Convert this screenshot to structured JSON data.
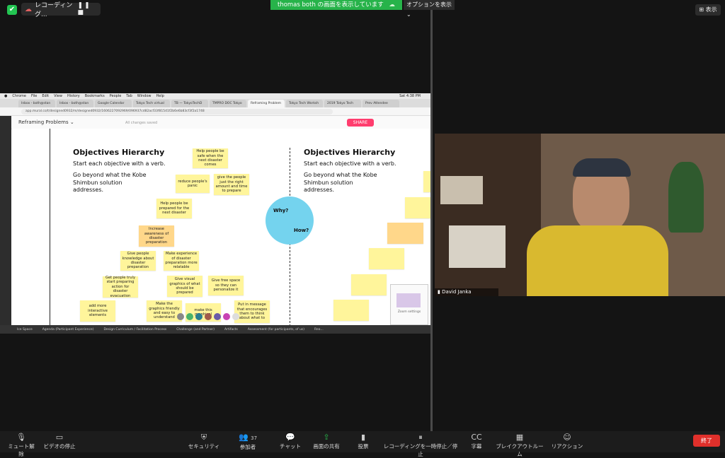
{
  "zoom": {
    "recording_label": "レコーディング...",
    "share_banner": "thomas both の画面を表示しています",
    "options_label": "オプションを表示",
    "view_label": "表示",
    "end_label": "終了",
    "participants_count": "37",
    "toolbar": [
      {
        "label": "ミュート解除",
        "icon": "🎙"
      },
      {
        "label": "ビデオの停止",
        "icon": "▭"
      },
      {
        "label": "セキュリティ",
        "icon": "⛨"
      },
      {
        "label": "参加者",
        "icon": "👥"
      },
      {
        "label": "チャット",
        "icon": "💬"
      },
      {
        "label": "画面の共有",
        "icon": "⇪"
      },
      {
        "label": "投票",
        "icon": "▮"
      },
      {
        "label": "レコーディングを一時停止／停止",
        "icon": "⏸"
      },
      {
        "label": "字幕",
        "icon": "CC"
      },
      {
        "label": "ブレイクアウトルーム",
        "icon": "▦"
      },
      {
        "label": "リアクション",
        "icon": "☺"
      }
    ]
  },
  "video": {
    "name": "David Janka"
  },
  "browser": {
    "mac_menu": [
      "Chrome",
      "File",
      "Edit",
      "View",
      "History",
      "Bookmarks",
      "People",
      "Tab",
      "Window",
      "Help"
    ],
    "clock": "Sat 4:38 PM",
    "tabs": [
      "Inbox - both@stan",
      "Inbox - both@stan",
      "Google Calendar",
      "Tokyo Tech virtual",
      "TB — TokyoTechD",
      "TMPRO DOC Tokyo",
      "Reframing Problem",
      "Tokyo Tech Worksh",
      "2019 Tokyo Tech",
      "Prev Attendee"
    ],
    "url": "app.mural.co/t/designed0932/m/designed0932/1606227092969/096937cd82acf33f81541f2b6e6b83cf3f2a1748",
    "mural_title": "Reframing Problems",
    "saved_label": "All changes saved",
    "share_label": "SHARE",
    "bottom_tabs": [
      "Ice Space",
      "Agenda (Participant Experience)",
      "Design Curriculum / Facilitation Process",
      "Challenge (and Partner)",
      "Artifacts",
      "Assessment (for participants, of us)",
      "Rea..."
    ]
  },
  "canvas": {
    "left": {
      "title": "Objectives Hierarchy",
      "line1": "Start each objective with a verb.",
      "line2": "Go beyond what the Kobe Shimbun solution addresses."
    },
    "right": {
      "title": "Objectives Hierarchy",
      "line1": "Start each objective with a verb.",
      "line2": "Go beyond what the Kobe Shimbun solution addresses."
    },
    "why": "Why?",
    "how": "How?",
    "stickies": {
      "s1": "Help people be safe when the next disaster comes",
      "s2": "reduce people's panic",
      "s3": "give the people just the right amount and time to prepare",
      "s4": "Help people be prepared for the next disaster",
      "s5": "Increase awareness of disaster preparation",
      "s6": "Give people knowledge about disaster preparation",
      "s7": "Make experience of disaster preparation more relatable",
      "s8": "Get people truly start preparing action for disaster evacuation",
      "s9": "Give visual graphics of what should be prepared",
      "s10": "Give free space so they can personalize it",
      "s11": "add more interactive elements",
      "s12": "Make the graphics friendly and easy to understand",
      "s13": "make this graphical",
      "s14": "Put in message that encourages them to think about what to"
    },
    "minimap_label": "Zoom settings"
  }
}
